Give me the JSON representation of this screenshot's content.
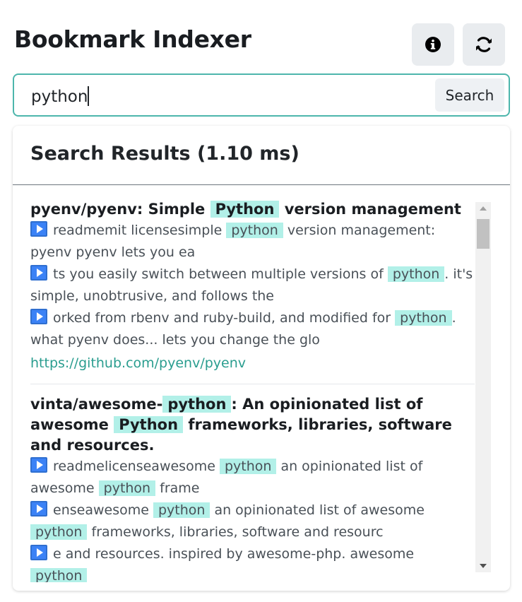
{
  "app": {
    "title": "Bookmark Indexer"
  },
  "toolbar": {
    "info_icon": "info-circle-icon",
    "refresh_icon": "refresh-icon"
  },
  "search": {
    "value": "python",
    "button_label": "Search"
  },
  "results": {
    "heading": "Search Results (1.10 ms)",
    "items": [
      {
        "title": {
          "a": "pyenv/pyenv: Simple ",
          "hl": "Python",
          "b": " version management"
        },
        "snippets": [
          {
            "a": "readmemit licensesimple ",
            "hl": "python",
            "b": " version management: pyenv pyenv lets you ea"
          },
          {
            "a": "ts you easily switch between multiple versions of ",
            "hl": "python",
            "b": ". it's simple, unobtrusive, and follows the"
          },
          {
            "a": "orked from rbenv and ruby-build, and modified for ",
            "hl": "python",
            "b": ". what pyenv does... lets you change the glo"
          }
        ],
        "url": "https://github.com/pyenv/pyenv"
      },
      {
        "title": {
          "a": "vinta/awesome-",
          "hl": "python",
          "b": ": An opinionated list of awesome ",
          "hl2": "Python",
          "c": " frameworks, libraries, software and resources."
        },
        "snippets": [
          {
            "a": "readmelicenseawesome ",
            "hl": "python",
            "b": " an opinionated list of awesome ",
            "hl2": "python",
            "c": " frame"
          },
          {
            "a": "enseawesome ",
            "hl": "python",
            "b": " an opinionated list of awesome ",
            "hl2": "python",
            "c": " frameworks, libraries, software and resourc"
          },
          {
            "a": "e and resources. inspired by awesome-php. awesome ",
            "hl": "python",
            "b": ""
          }
        ]
      }
    ]
  },
  "colors": {
    "accent": "#4db6ac",
    "highlight": "#b2f0e8",
    "link": "#2a9d8f",
    "play_icon": "#3b82f6"
  }
}
